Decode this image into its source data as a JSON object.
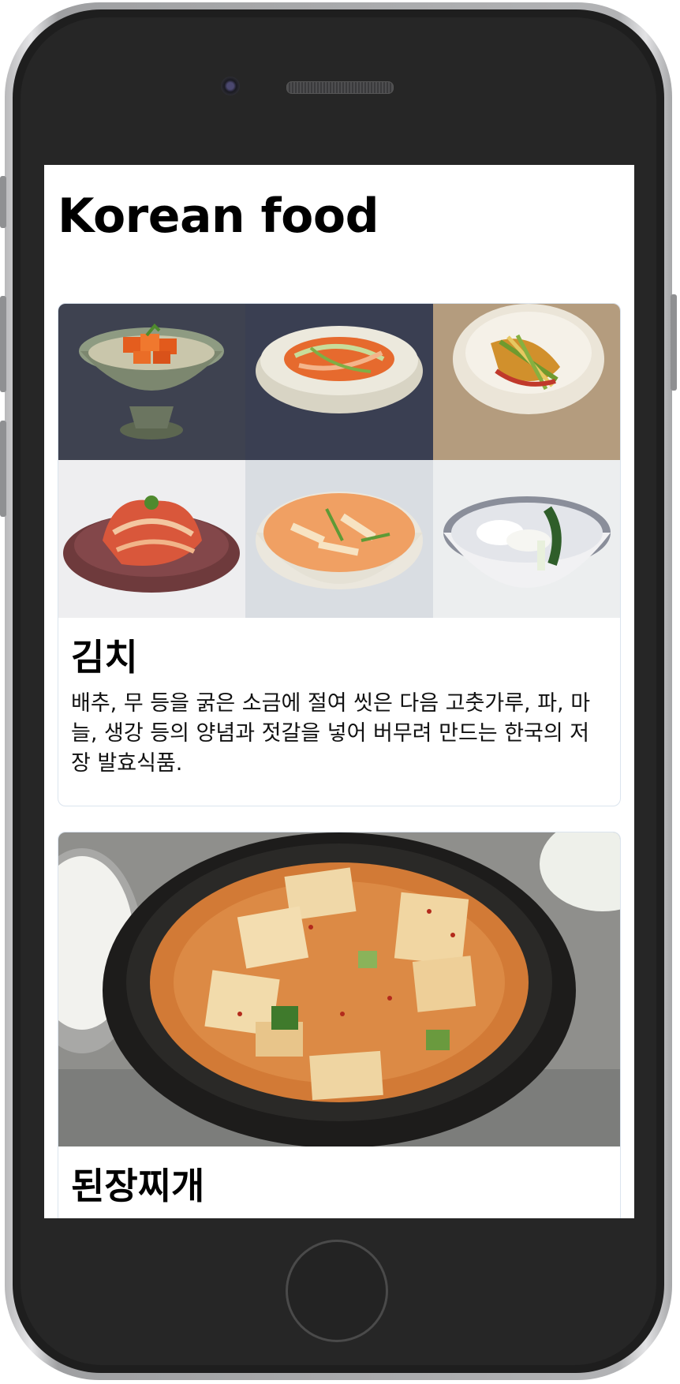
{
  "page": {
    "title": "Korean food"
  },
  "foods": [
    {
      "title": "김치",
      "description": "배추, 무 등을 굵은 소금에 절여 씻은 다음 고춧가루, 파, 마늘, 생강 등의 양념과 젓갈을 넣어 버무려 만드는 한국의 저장 발효식품."
    },
    {
      "title": "된장찌개",
      "description": ""
    }
  ],
  "icons": [
    "camera-icon",
    "speaker-icon",
    "home-button-icon"
  ]
}
